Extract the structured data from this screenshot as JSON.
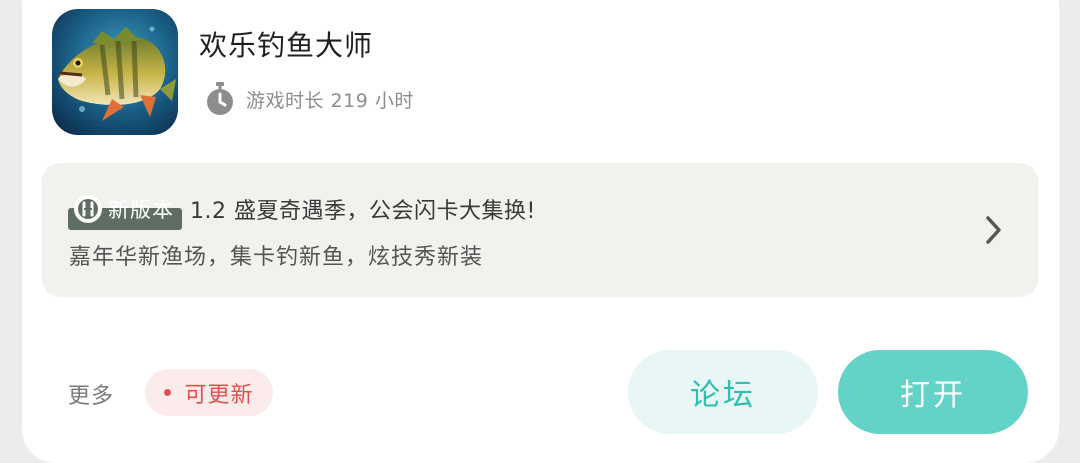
{
  "app": {
    "title": "欢乐钓鱼大师",
    "play_time": "游戏时长 219 小时",
    "icon": "fishing-game-app-icon"
  },
  "update": {
    "badge_label": "新版本",
    "headline": "1.2 盛夏奇遇季，公会闪卡大集换!",
    "description": "嘉年华新渔场，集卡钓新鱼，炫技秀新装"
  },
  "footer": {
    "more_label": "更多",
    "update_chip_label": "可更新",
    "forum_label": "论坛",
    "open_label": "打开"
  },
  "colors": {
    "accent": "#64d3c7",
    "accent_text": "#2fbfb0",
    "forum_bg": "#e8f6f6",
    "alert": "#e0514e",
    "badge_bg": "#5f6d62"
  }
}
